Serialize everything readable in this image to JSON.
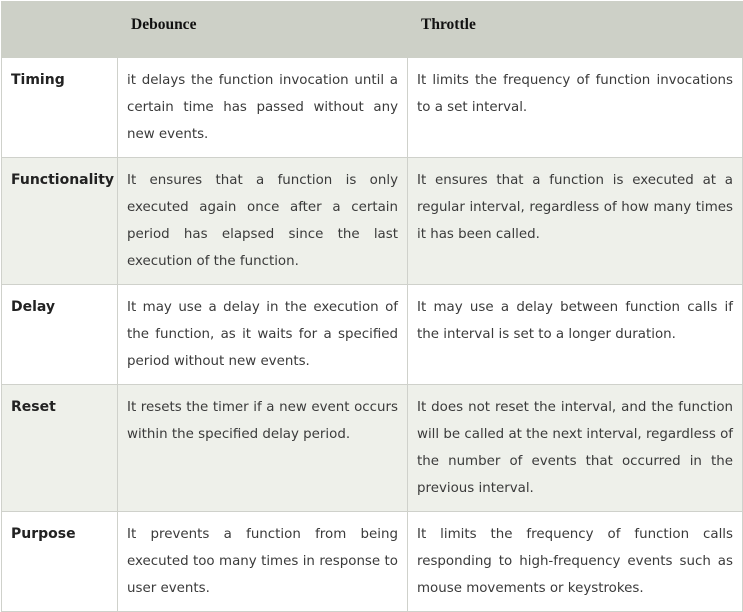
{
  "table": {
    "headers": [
      "",
      "Debounce",
      "Throttle"
    ],
    "rows": [
      {
        "label": "Timing",
        "debounce": "it delays the function invocation until a certain time has passed without any new events.",
        "throttle": "It limits the frequency of function invocations to a set interval."
      },
      {
        "label": "Functionality",
        "debounce": "It ensures that a function is only executed again once after a certain period has elapsed since the last execution of the function.",
        "throttle": "It ensures that a function is executed at a regular interval, regardless of how many times it has been called."
      },
      {
        "label": "Delay",
        "debounce": "It may use a delay in the execution of the function, as it waits for a specified period without new events.",
        "throttle": "It may use a delay between function calls if the interval is set to a longer duration."
      },
      {
        "label": "Reset",
        "debounce": "It resets the timer if a new event occurs within the specified delay period.",
        "throttle": "It does not reset the interval, and the function will be called at the next interval, regardless of the number of events that occurred in the previous interval."
      },
      {
        "label": "Purpose",
        "debounce": "It prevents a function from being executed too many times in response to user events.",
        "throttle": "It limits the frequency of function calls responding to high-frequency events such as mouse movements or keystrokes."
      }
    ]
  },
  "colors": {
    "header_bg": "#cdd0c7",
    "row_alt_bg": "#eef0ea",
    "border": "#cfd1cb",
    "text": "#3a3a3a"
  }
}
